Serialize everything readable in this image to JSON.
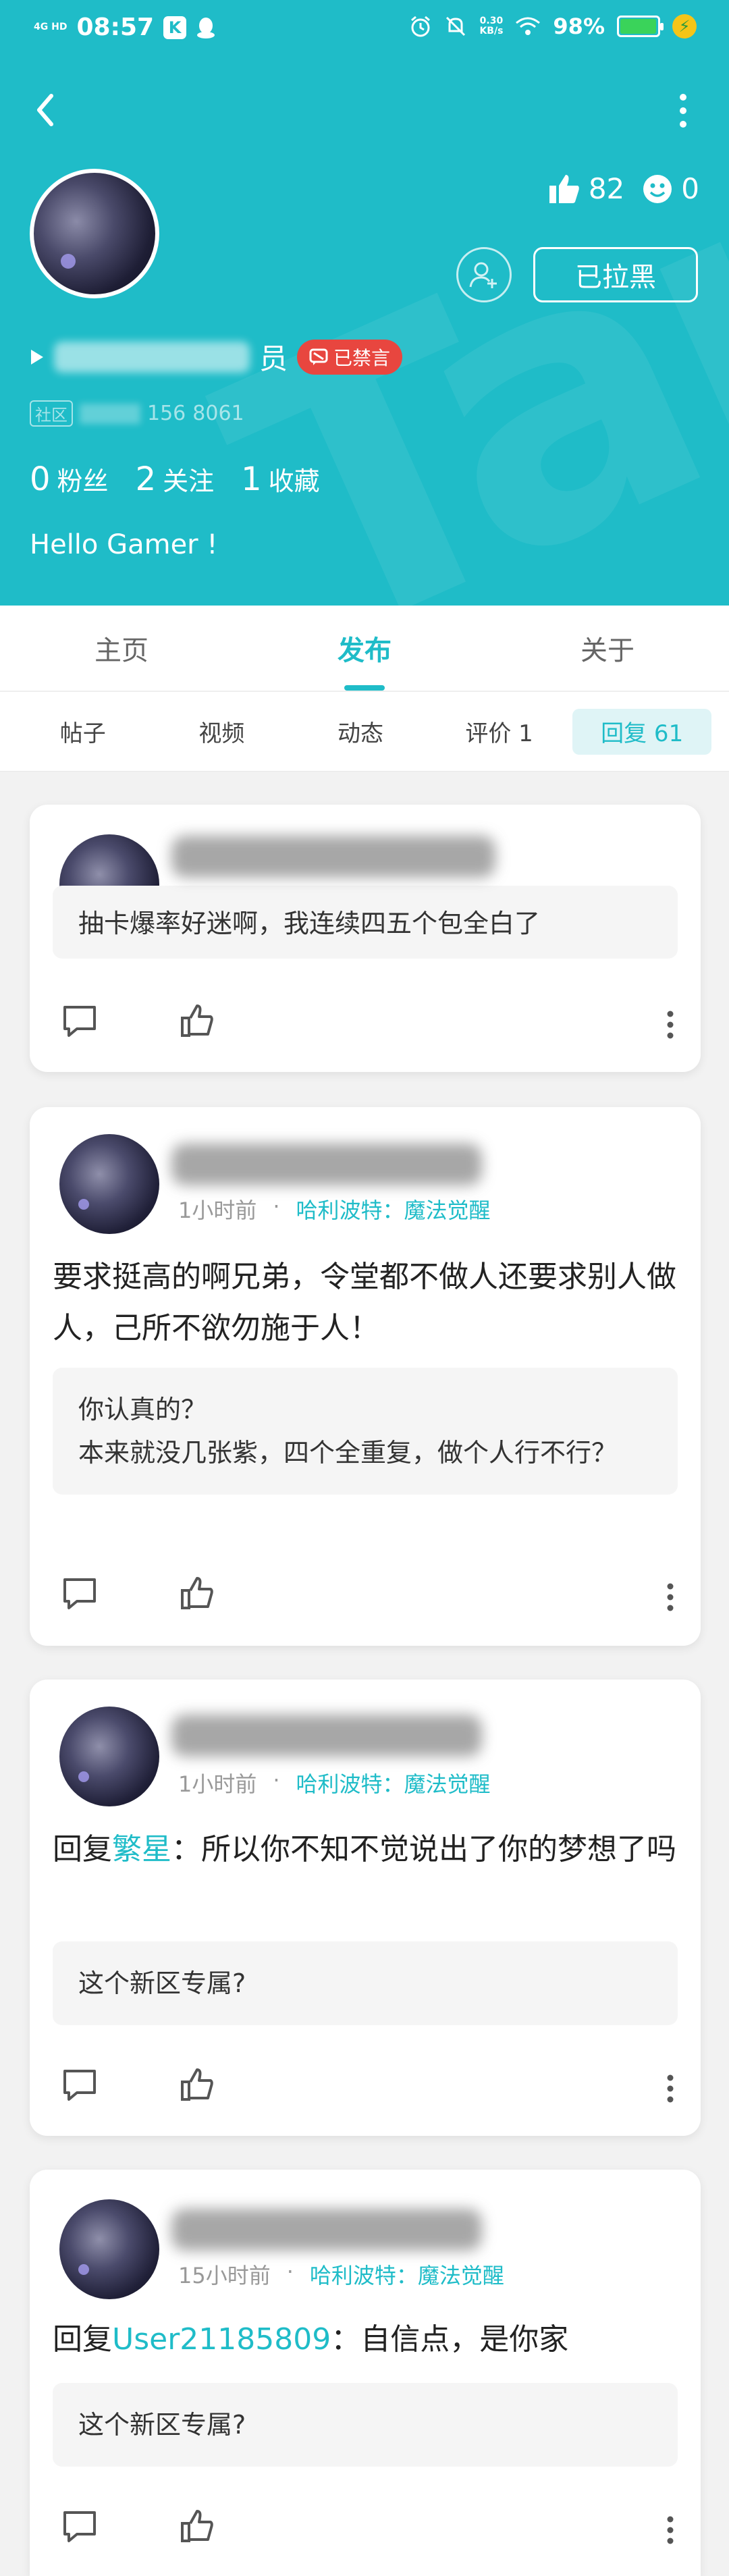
{
  "status_bar": {
    "network": "4G HD",
    "time": "08:57",
    "k_icon": "K",
    "speed_value": "0.30",
    "speed_unit": "KB/s",
    "battery": "98%",
    "battery_level": 0.98
  },
  "profile": {
    "likes": "82",
    "smiles": "0",
    "blocked_label": "已拉黑",
    "name_suffix": "员",
    "banned_label": "已禁言",
    "id_chip": "社区",
    "id_visible": "156",
    "id_tail": "8061",
    "fans_count": "0",
    "fans_label": "粉丝",
    "following_count": "2",
    "following_label": "关注",
    "favorites_count": "1",
    "favorites_label": "收藏",
    "bio": "Hello Gamer !"
  },
  "tabs": {
    "main": [
      "主页",
      "发布",
      "关于"
    ],
    "active_main": "发布",
    "sub": [
      "帖子",
      "视频",
      "动态",
      "评价 1",
      "回复 61"
    ],
    "active_sub": "回复 61"
  },
  "posts": [
    {
      "text_line": "抽卡爆率好迷啊，我连续四五个包全白了"
    },
    {
      "time": "1小时前",
      "game": "哈利波特：魔法觉醒",
      "text": "要求挺高的啊兄弟，令堂都不做人还要求别人做人，己所不欲勿施于人！",
      "quote_line1": "你认真的？",
      "quote_line2": "本来就没几张紫，四个全重复，做个人行不行？"
    },
    {
      "time": "1小时前",
      "game": "哈利波特：魔法觉醒",
      "reply_prefix": "回复",
      "reply_to": "繁星",
      "text": "：所以你不知不觉说出了你的梦想了吗",
      "quote": "这个新区专属?"
    },
    {
      "time": "15小时前",
      "game": "哈利波特：魔法觉醒",
      "reply_prefix": "回复",
      "reply_to": "User21185809",
      "text": "：自信点，是你家",
      "quote": "这个新区专属?"
    }
  ],
  "colors": {
    "accent": "#1fbcc8",
    "banned": "#e8463f",
    "background": "#f2f2f2"
  }
}
